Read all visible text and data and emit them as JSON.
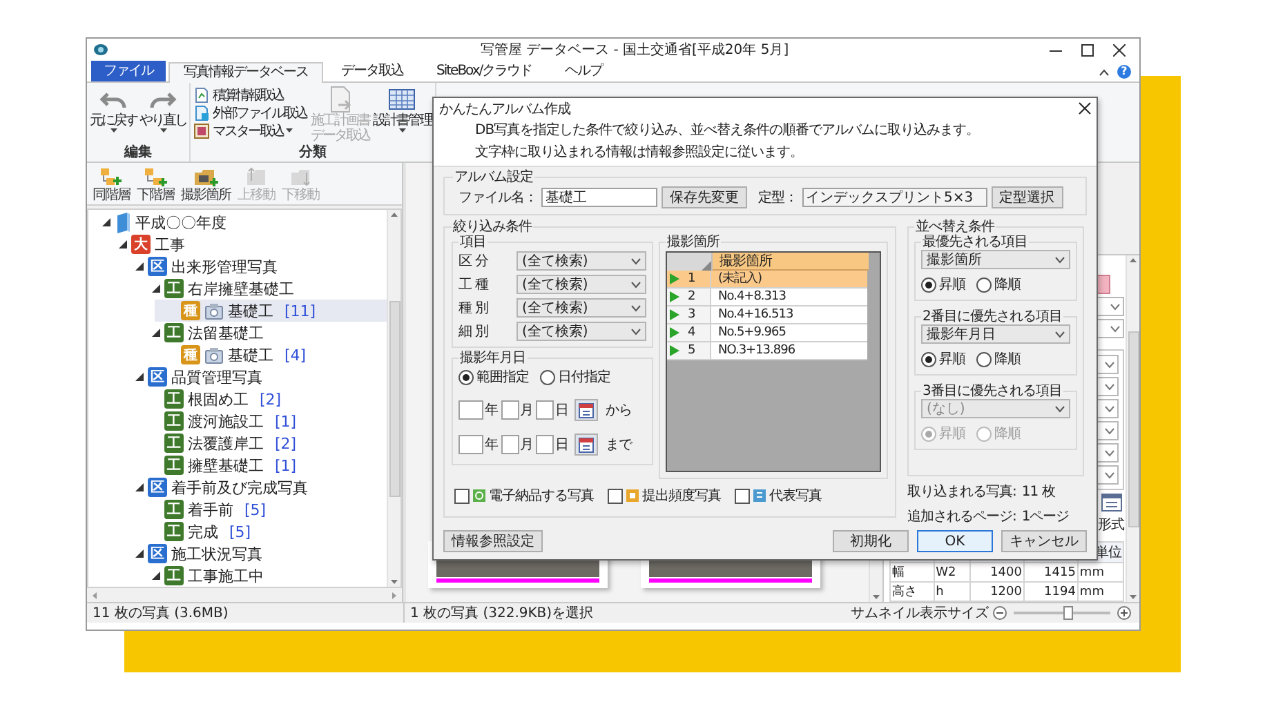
{
  "window": {
    "title": "写管屋 データベース - 国土交通省[平成20年 5月]",
    "help": "?"
  },
  "ribbon": {
    "tabs": [
      {
        "label": "ファイル",
        "kind": "file",
        "selected": false
      },
      {
        "label": "写真情報データベース",
        "kind": "tab",
        "selected": true
      },
      {
        "label": "データ取込",
        "kind": "tab",
        "selected": false
      },
      {
        "label": "SiteBox/クラウド",
        "kind": "tab",
        "selected": false
      },
      {
        "label": "ヘルプ",
        "kind": "tab",
        "selected": false
      }
    ],
    "groups": [
      {
        "label": "編集",
        "items": [
          {
            "kind": "undo",
            "label": "元に戻す",
            "dropdown": true,
            "disabled": false
          },
          {
            "kind": "redo",
            "label": "やり直し",
            "dropdown": true,
            "disabled": false
          }
        ]
      },
      {
        "label": "分類",
        "items": [
          {
            "kind": "stack",
            "entries": [
              {
                "kind": "estimate",
                "label": "積算情報取込",
                "dropdown": false
              },
              {
                "kind": "external",
                "label": "外部ファイル取込",
                "dropdown": false
              },
              {
                "kind": "master",
                "label": "マスター取込",
                "dropdown": true
              }
            ]
          },
          {
            "kind": "plan",
            "label": "施工計画書データ取込",
            "dropdown": false,
            "disabled": true
          },
          {
            "kind": "design",
            "label": "設計書管理",
            "dropdown": true,
            "disabled": false
          }
        ]
      }
    ]
  },
  "tree_toolbar": [
    {
      "kind": "sibling",
      "label": "同階層",
      "disabled": false
    },
    {
      "kind": "child",
      "label": "下階層",
      "disabled": false
    },
    {
      "kind": "location",
      "label": "撮影箇所",
      "disabled": false
    },
    {
      "kind": "up",
      "label": "上移動",
      "disabled": true
    },
    {
      "kind": "down",
      "label": "下移動",
      "disabled": true
    }
  ],
  "tree": [
    {
      "kind": "year",
      "label": "平成〇〇年度",
      "expanded": true,
      "selected": false,
      "children": [
        {
          "kind": "work",
          "badge": "大",
          "label": "工事",
          "expanded": true,
          "selected": false,
          "children": [
            {
              "kind": "section",
              "badge": "区",
              "label": "出来形管理写真",
              "expanded": true,
              "selected": false,
              "children": [
                {
                  "kind": "type",
                  "badge": "工",
                  "label": "右岸擁壁基礎工",
                  "expanded": true,
                  "selected": false,
                  "children": [
                    {
                      "kind": "detail",
                      "badge": "種",
                      "label": "基礎工",
                      "count": "[11]",
                      "selected": true
                    }
                  ]
                },
                {
                  "kind": "type",
                  "badge": "工",
                  "label": "法留基礎工",
                  "expanded": true,
                  "selected": false,
                  "children": [
                    {
                      "kind": "detail",
                      "badge": "種",
                      "label": "基礎工",
                      "count": "[4]",
                      "selected": false
                    }
                  ]
                }
              ]
            },
            {
              "kind": "section",
              "badge": "区",
              "label": "品質管理写真",
              "expanded": true,
              "selected": false,
              "children": [
                {
                  "kind": "type",
                  "badge": "工",
                  "label": "根固め工",
                  "count": "[2]",
                  "selected": false
                },
                {
                  "kind": "type",
                  "badge": "工",
                  "label": "渡河施設工",
                  "count": "[1]",
                  "selected": false
                },
                {
                  "kind": "type",
                  "badge": "工",
                  "label": "法覆護岸工",
                  "count": "[2]",
                  "selected": false
                },
                {
                  "kind": "type",
                  "badge": "工",
                  "label": "擁壁基礎工",
                  "count": "[1]",
                  "selected": false
                }
              ]
            },
            {
              "kind": "section",
              "badge": "区",
              "label": "着手前及び完成写真",
              "expanded": true,
              "selected": false,
              "children": [
                {
                  "kind": "type",
                  "badge": "工",
                  "label": "着手前",
                  "count": "[5]",
                  "selected": false
                },
                {
                  "kind": "type",
                  "badge": "工",
                  "label": "完成",
                  "count": "[5]",
                  "selected": false
                }
              ]
            },
            {
              "kind": "section",
              "badge": "区",
              "label": "施工状況写真",
              "expanded": true,
              "selected": false,
              "children": [
                {
                  "kind": "type",
                  "badge": "工",
                  "label": "工事施工中",
                  "expanded": true,
                  "selected": false
                }
              ]
            }
          ]
        }
      ]
    }
  ],
  "thumbnails": [
    {
      "marked": true
    },
    {
      "marked": true
    }
  ],
  "properties": {
    "format_label": "形式",
    "unit_header": "単位",
    "rows": [
      [
        "幅",
        "W2",
        "1400",
        "1415",
        "mm"
      ],
      [
        "高さ",
        "h",
        "1200",
        "1194",
        "mm"
      ]
    ]
  },
  "status_bar": {
    "total": "11 枚の写真 (3.6MB)",
    "selection": "1 枚の写真 (322.9KB)を選択",
    "zoom": {
      "label": "サムネイル表示サイズ",
      "level": 0.55
    }
  },
  "dialog": {
    "title": "かんたんアルバム作成",
    "description": [
      "DB写真を指定した条件で絞り込み、並べ替え条件の順番でアルバムに取り込みます。",
      "文字枠に取り込まれる情報は情報参照設定に従います。"
    ],
    "album": {
      "legend": "アルバム設定",
      "file_label": "ファイル名：",
      "file_value": "基礎工",
      "save_button": "保存先変更",
      "template_label": "定型：",
      "template_value": "インデックスプリント5×3",
      "template_button": "定型選択"
    },
    "filter": {
      "legend": "絞り込み条件",
      "items_legend": "項目",
      "items": [
        {
          "label": "区 分",
          "value": "(全て検索)"
        },
        {
          "label": "工 種",
          "value": "(全て検索)"
        },
        {
          "label": "種 別",
          "value": "(全て検索)"
        },
        {
          "label": "細 別",
          "value": "(全て検索)"
        }
      ],
      "date": {
        "legend": "撮影年月日",
        "modes": [
          {
            "label": "範囲指定",
            "selected": true
          },
          {
            "label": "日付指定",
            "selected": false
          }
        ],
        "rows": [
          {
            "units": [
              "年",
              "月",
              "日"
            ],
            "suffix": "から"
          },
          {
            "units": [
              "年",
              "月",
              "日"
            ],
            "suffix": "まで"
          }
        ]
      },
      "locations": {
        "legend": "撮影箇所",
        "column": "撮影箇所",
        "rows": [
          {
            "no": "1",
            "value": "(未記入)",
            "selected": true
          },
          {
            "no": "2",
            "value": "No.4+8.313",
            "selected": false
          },
          {
            "no": "3",
            "value": "No.4+16.513",
            "selected": false
          },
          {
            "no": "4",
            "value": "No.5+9.965",
            "selected": false
          },
          {
            "no": "5",
            "value": "NO.3+13.896",
            "selected": false
          }
        ]
      },
      "flags": [
        {
          "kind": "delivery",
          "label": "電子納品する写真",
          "checked": false
        },
        {
          "kind": "frequency",
          "label": "提出頻度写真",
          "checked": false
        },
        {
          "kind": "representative",
          "label": "代表写真",
          "checked": false
        }
      ]
    },
    "sort": {
      "legend": "並べ替え条件",
      "levels": [
        {
          "label": "最優先される項目",
          "value": "撮影箇所",
          "disabled": false,
          "orders": [
            {
              "label": "昇順",
              "selected": true
            },
            {
              "label": "降順",
              "selected": false
            }
          ]
        },
        {
          "label": "2番目に優先される項目",
          "value": "撮影年月日",
          "disabled": false,
          "orders": [
            {
              "label": "昇順",
              "selected": true
            },
            {
              "label": "降順",
              "selected": false
            }
          ]
        },
        {
          "label": "3番目に優先される項目",
          "value": "(なし)",
          "disabled": true,
          "orders": [
            {
              "label": "昇順",
              "selected": true
            },
            {
              "label": "降順",
              "selected": false
            }
          ]
        }
      ]
    },
    "summary": [
      {
        "label": "取り込まれる写真:",
        "value": "11 枚"
      },
      {
        "label": "追加されるページ:",
        "value": "1ページ"
      }
    ],
    "info_button": "情報参照設定",
    "buttons": [
      {
        "label": "初期化",
        "default": false
      },
      {
        "label": "OK",
        "default": true
      },
      {
        "label": "キャンセル",
        "default": false
      }
    ]
  }
}
